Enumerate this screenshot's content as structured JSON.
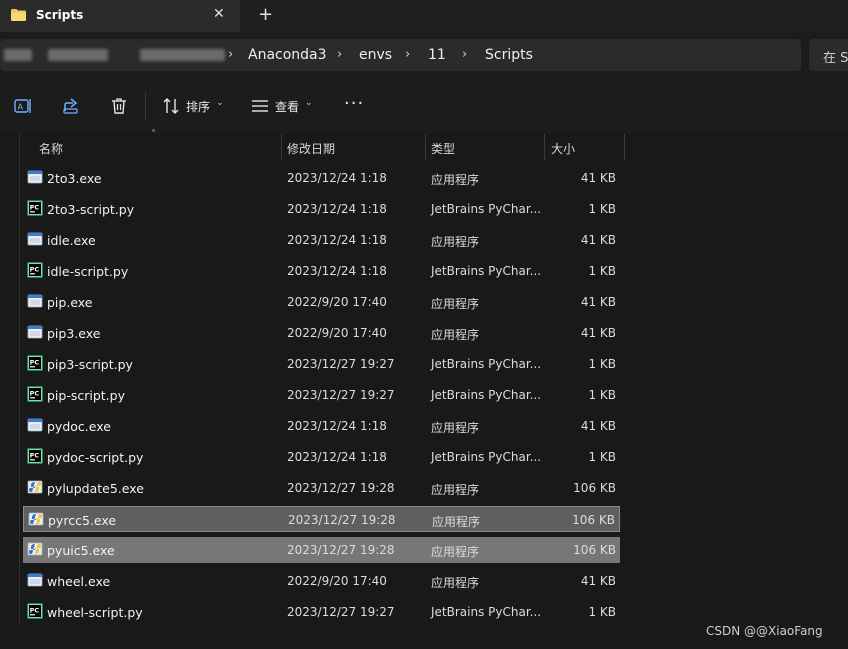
{
  "tab": {
    "title": "Scripts",
    "close": "✕",
    "new_tab": "+"
  },
  "breadcrumb": [
    "Anaconda3",
    "envs",
    "11",
    "Scripts"
  ],
  "search_placeholder": "在 S",
  "toolbar": {
    "sort_label": "排序",
    "view_label": "查看",
    "more": "···"
  },
  "columns": {
    "name": "名称",
    "date": "修改日期",
    "type": "类型",
    "size": "大小"
  },
  "files": [
    {
      "name": "2to3.exe",
      "date": "2023/12/24 1:18",
      "type": "应用程序",
      "size": "41 KB",
      "icon": "exe-icon"
    },
    {
      "name": "2to3-script.py",
      "date": "2023/12/24 1:18",
      "type": "JetBrains PyChar...",
      "size": "1 KB",
      "icon": "pycharm-file-icon"
    },
    {
      "name": "idle.exe",
      "date": "2023/12/24 1:18",
      "type": "应用程序",
      "size": "41 KB",
      "icon": "exe-icon"
    },
    {
      "name": "idle-script.py",
      "date": "2023/12/24 1:18",
      "type": "JetBrains PyChar...",
      "size": "1 KB",
      "icon": "pycharm-file-icon"
    },
    {
      "name": "pip.exe",
      "date": "2022/9/20 17:40",
      "type": "应用程序",
      "size": "41 KB",
      "icon": "exe-icon"
    },
    {
      "name": "pip3.exe",
      "date": "2022/9/20 17:40",
      "type": "应用程序",
      "size": "41 KB",
      "icon": "exe-icon"
    },
    {
      "name": "pip3-script.py",
      "date": "2023/12/27 19:27",
      "type": "JetBrains PyChar...",
      "size": "1 KB",
      "icon": "pycharm-file-icon"
    },
    {
      "name": "pip-script.py",
      "date": "2023/12/27 19:27",
      "type": "JetBrains PyChar...",
      "size": "1 KB",
      "icon": "pycharm-file-icon"
    },
    {
      "name": "pydoc.exe",
      "date": "2023/12/24 1:18",
      "type": "应用程序",
      "size": "41 KB",
      "icon": "exe-icon"
    },
    {
      "name": "pydoc-script.py",
      "date": "2023/12/24 1:18",
      "type": "JetBrains PyChar...",
      "size": "1 KB",
      "icon": "pycharm-file-icon"
    },
    {
      "name": "pylupdate5.exe",
      "date": "2023/12/27 19:28",
      "type": "应用程序",
      "size": "106 KB",
      "icon": "python-exe-icon"
    },
    {
      "name": "pyrcc5.exe",
      "date": "2023/12/27 19:28",
      "type": "应用程序",
      "size": "106 KB",
      "icon": "python-exe-icon",
      "selected": "secondary"
    },
    {
      "name": "pyuic5.exe",
      "date": "2023/12/27 19:28",
      "type": "应用程序",
      "size": "106 KB",
      "icon": "python-exe-icon",
      "selected": "primary"
    },
    {
      "name": "wheel.exe",
      "date": "2022/9/20 17:40",
      "type": "应用程序",
      "size": "41 KB",
      "icon": "exe-icon"
    },
    {
      "name": "wheel-script.py",
      "date": "2023/12/27 19:27",
      "type": "JetBrains PyChar...",
      "size": "1 KB",
      "icon": "pycharm-file-icon"
    }
  ],
  "watermark": "CSDN @@XiaoFang"
}
